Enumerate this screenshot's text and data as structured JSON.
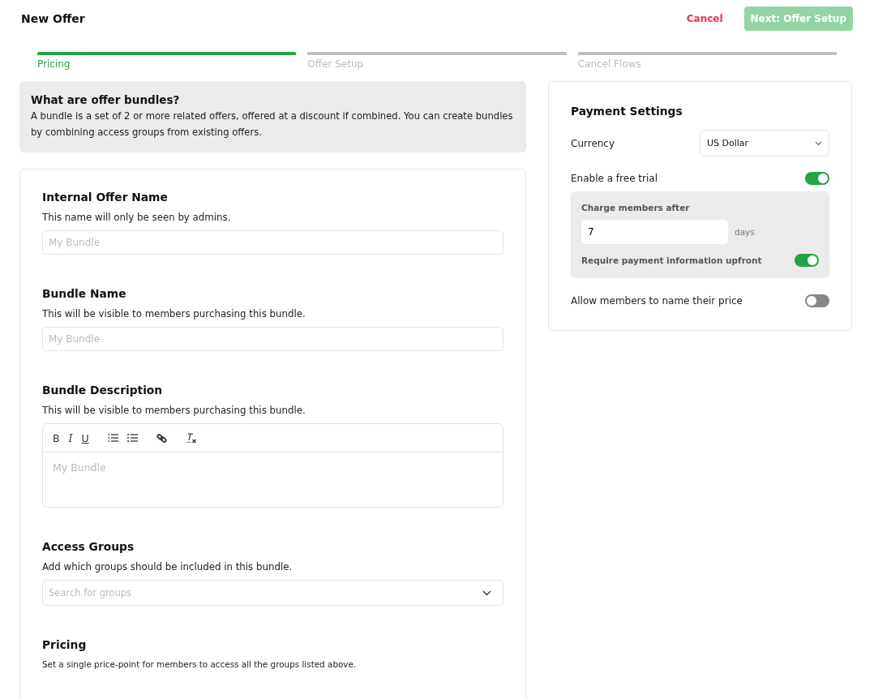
{
  "header": {
    "title": "New Offer",
    "cancel": "Cancel",
    "next": {
      "label": "Next: Offer Setup",
      "disabled": true
    }
  },
  "steps": [
    {
      "label": "Pricing",
      "selected": true
    },
    {
      "label": "Offer Setup",
      "selected": false
    },
    {
      "label": "Cancel Flows",
      "selected": false
    }
  ],
  "info": {
    "title": "What are offer bundles?",
    "text": "A bundle is a set of 2 or more related offers, offered at a discount if combined. You can create bundles by combining access groups from existing offers."
  },
  "sections": [
    {
      "kind": "input",
      "title": "Internal Offer Name",
      "description": "This name will only be seen by admins.",
      "placeholder": "My Bundle"
    },
    {
      "kind": "input",
      "title": "Bundle Name",
      "description": "This will be visible to members purchasing this bundle.",
      "placeholder": "My Bundle"
    },
    {
      "kind": "editor",
      "title": "Bundle Description",
      "description": "This will be visible to members purchasing this bundle.",
      "toolbar": [
        "B",
        "I",
        "U"
      ],
      "placeholder": "My Bundle"
    },
    {
      "kind": "select",
      "title": "Access Groups",
      "description": "Add which groups should be included in this bundle.",
      "placeholder": "Search for groups"
    },
    {
      "kind": "text",
      "title": "Pricing",
      "description": "Set a single price-point for members to access all the groups listed above."
    }
  ],
  "payment": {
    "title": "Payment Settings",
    "currency_label": "Currency",
    "currency": "US Dollar",
    "free_trial": {
      "label": "Enable a free trial",
      "on": true,
      "charge_label": "Charge members after",
      "days": "7",
      "unit": "days",
      "require_label": "Require payment information upfront",
      "require_on": true
    },
    "name_price": {
      "label": "Allow members to name their price",
      "on": false
    }
  }
}
